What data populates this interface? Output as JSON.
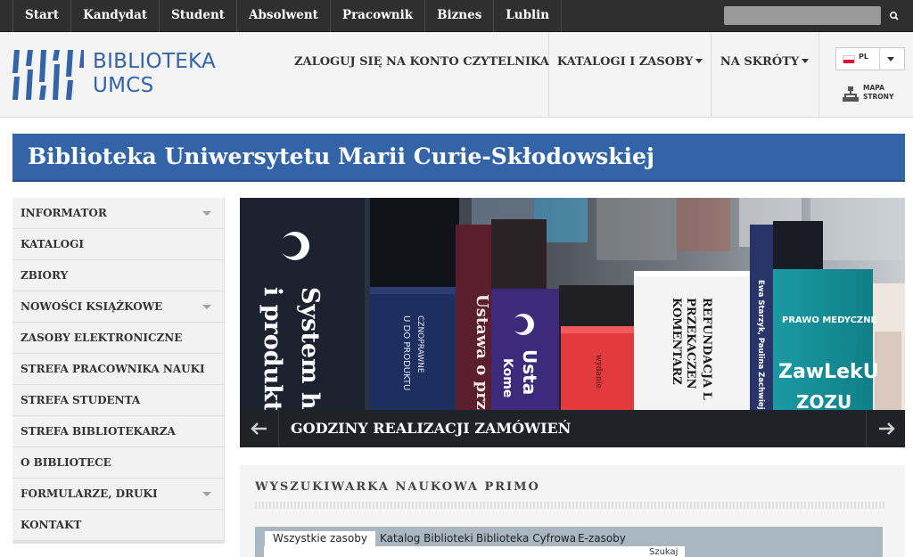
{
  "topbar": {
    "nav": [
      {
        "label": "Start"
      },
      {
        "label": "Kandydat"
      },
      {
        "label": "Student"
      },
      {
        "label": "Absolwent"
      },
      {
        "label": "Pracownik"
      },
      {
        "label": "Biznes"
      },
      {
        "label": "Lublin"
      }
    ],
    "search_placeholder": "",
    "search_icon": "magnifier-icon"
  },
  "header": {
    "logo_line1": "BIBLIOTEKA",
    "logo_line2": "UMCS",
    "nav": {
      "login": "ZALOGUJ SIĘ NA KONTO CZYTELNIKA",
      "catalogs": "KATALOGI I ZASOBY",
      "shortcuts": "NA SKRÓTY"
    },
    "lang": "PL",
    "sitemap_line1": "MAPA",
    "sitemap_line2": "STRONY"
  },
  "banner": {
    "title": "Biblioteka Uniwersytetu Marii Curie-Skłodowskiej"
  },
  "sidebar": {
    "items": [
      {
        "label": "INFORMATOR",
        "has_submenu": true
      },
      {
        "label": "KATALOGI",
        "has_submenu": false
      },
      {
        "label": "ZBIORY",
        "has_submenu": false
      },
      {
        "label": "NOWOŚCI KSIĄŻKOWE",
        "has_submenu": true
      },
      {
        "label": "ZASOBY ELEKTRONICZNE",
        "has_submenu": false
      },
      {
        "label": "STREFA PRACOWNIKA NAUKI",
        "has_submenu": false
      },
      {
        "label": "STREFA STUDENTA",
        "has_submenu": false
      },
      {
        "label": "STREFA BIBLIOTEKARZA",
        "has_submenu": false
      },
      {
        "label": "O BIBLIOTECE",
        "has_submenu": false
      },
      {
        "label": "FORMULARZE, DRUKI",
        "has_submenu": true
      },
      {
        "label": "KONTAKT",
        "has_submenu": false
      }
    ]
  },
  "slider": {
    "caption": "GODZINY REALIZACJI ZAMÓWIEŃ",
    "books": {
      "b1": "System har",
      "b1b": "i produktar",
      "b2": "U DO PRODUKTU",
      "b2b": "CZNOPRAWNE",
      "b3": "Ustawa o prze",
      "b4": "Usta",
      "b4b": "Kome",
      "b5": "wydanie",
      "b6a": "REFUNDACJA L",
      "b6b": "PRZEKACZEN",
      "b6c": "KOMENTARZ",
      "b7": "Ewa Starzyk, Paulina Zachwieja",
      "b8a": "PRAWO MEDYCZNE",
      "b8b": "ZawLekU",
      "b8c": "ZOZU"
    }
  },
  "primo": {
    "title": "WYSZUKIWARKA NAUKOWA PRIMO",
    "tabs": [
      "Wszystkie zasoby",
      "Katalog Biblioteki",
      "Biblioteka Cyfrowa",
      "E-zasoby"
    ],
    "search_label": "Szukaj"
  },
  "colors": {
    "brand_blue": "#3464a8",
    "topbar": "#2f2f2f"
  }
}
